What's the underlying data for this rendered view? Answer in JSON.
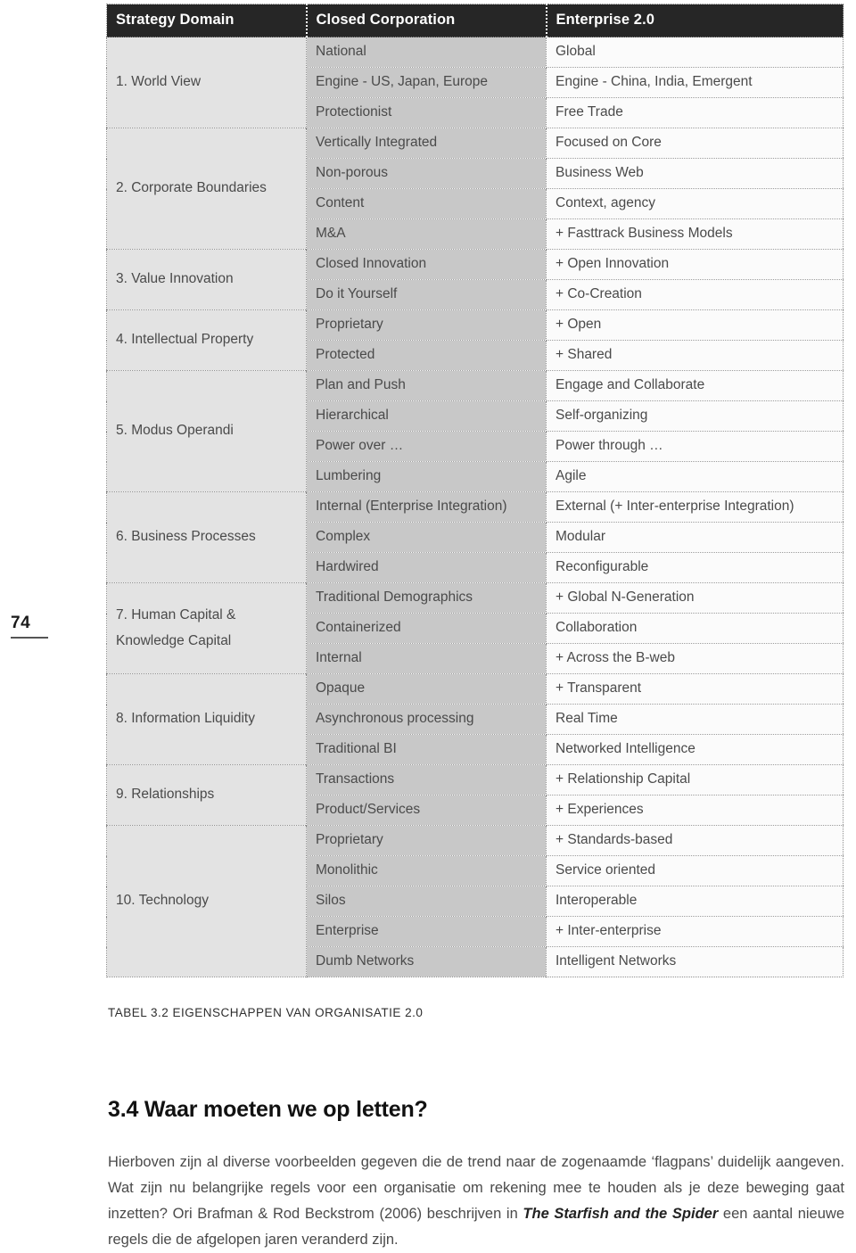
{
  "page": {
    "number": "74"
  },
  "table": {
    "headers": [
      "Strategy Domain",
      "Closed Corporation",
      "Enterprise 2.0"
    ],
    "caption": "TABEL 3.2 EIGENSCHAPPEN VAN ORGANISATIE 2.0",
    "colors": {
      "header_bg": "#262626",
      "header_text": "#ffffff",
      "col1_bg": "#e3e3e3",
      "col2_bg": "#c8c8c8",
      "col3_bg": "#fbfbfb",
      "body_text": "#4a4a4a",
      "border": "#8c8c8c"
    },
    "groups": [
      {
        "domain": "1. World View",
        "domain_line2": "",
        "rows": [
          {
            "closed": "National",
            "enterprise": "Global"
          },
          {
            "closed": "Engine - US, Japan, Europe",
            "enterprise": "Engine - China, India, Emergent"
          },
          {
            "closed": "Protectionist",
            "enterprise": "Free Trade"
          }
        ]
      },
      {
        "domain": "2. Corporate Boundaries",
        "domain_line2": "",
        "rows": [
          {
            "closed": "Vertically Integrated",
            "enterprise": "Focused on Core"
          },
          {
            "closed": "Non-porous",
            "enterprise": "Business Web"
          },
          {
            "closed": "Content",
            "enterprise": "Context, agency"
          },
          {
            "closed": "M&A",
            "enterprise": "+ Fasttrack Business Models"
          }
        ]
      },
      {
        "domain": "3. Value Innovation",
        "domain_line2": "",
        "rows": [
          {
            "closed": "Closed Innovation",
            "enterprise": "+ Open Innovation"
          },
          {
            "closed": "Do it Yourself",
            "enterprise": "+ Co-Creation"
          }
        ]
      },
      {
        "domain": "4. Intellectual Property",
        "domain_line2": "",
        "rows": [
          {
            "closed": "Proprietary",
            "enterprise": "+ Open"
          },
          {
            "closed": "Protected",
            "enterprise": "+ Shared"
          }
        ]
      },
      {
        "domain": "5. Modus Operandi",
        "domain_line2": "",
        "rows": [
          {
            "closed": "Plan and Push",
            "enterprise": "Engage and Collaborate"
          },
          {
            "closed": "Hierarchical",
            "enterprise": "Self-organizing"
          },
          {
            "closed": "Power over …",
            "enterprise": "Power through …"
          },
          {
            "closed": "Lumbering",
            "enterprise": "Agile"
          }
        ]
      },
      {
        "domain": "6. Business Processes",
        "domain_line2": "",
        "rows": [
          {
            "closed": "Internal (Enterprise Integration)",
            "enterprise": "External (+ Inter-enterprise Integration)"
          },
          {
            "closed": "Complex",
            "enterprise": "Modular"
          },
          {
            "closed": "Hardwired",
            "enterprise": "Reconfigurable"
          }
        ]
      },
      {
        "domain": "7. Human Capital &",
        "domain_line2": "Knowledge Capital",
        "rows": [
          {
            "closed": "Traditional Demographics",
            "enterprise": "+ Global N-Generation"
          },
          {
            "closed": "Containerized",
            "enterprise": "Collaboration"
          },
          {
            "closed": "Internal",
            "enterprise": "+ Across the B-web"
          }
        ]
      },
      {
        "domain": "8. Information Liquidity",
        "domain_line2": "",
        "rows": [
          {
            "closed": "Opaque",
            "enterprise": "+ Transparent"
          },
          {
            "closed": "Asynchronous processing",
            "enterprise": "Real Time"
          },
          {
            "closed": "Traditional BI",
            "enterprise": "Networked Intelligence"
          }
        ]
      },
      {
        "domain": "9. Relationships",
        "domain_line2": "",
        "rows": [
          {
            "closed": "Transactions",
            "enterprise": "+ Relationship Capital"
          },
          {
            "closed": "Product/Services",
            "enterprise": "+ Experiences"
          }
        ]
      },
      {
        "domain": "10. Technology",
        "domain_line2": "",
        "rows": [
          {
            "closed": "Proprietary",
            "enterprise": "+ Standards-based"
          },
          {
            "closed": "Monolithic",
            "enterprise": "Service oriented"
          },
          {
            "closed": "Silos",
            "enterprise": "Interoperable"
          },
          {
            "closed": "Enterprise",
            "enterprise": "+ Inter-enterprise"
          },
          {
            "closed": "Dumb Networks",
            "enterprise": "Intelligent Networks"
          }
        ]
      }
    ]
  },
  "section": {
    "heading": "3.4 Waar moeten we op letten?",
    "paragraph_part1": "Hierboven zijn al diverse voorbeelden gegeven die de trend naar de zogenaamde ‘flagpans’ duidelijk aangeven. Wat zijn nu belangrijke regels voor een organisatie om rekening mee te houden als je deze beweging gaat inzetten? Ori Brafman & Rod Beckstrom (2006) beschrijven in ",
    "paragraph_italic": "The Starfish and the Spider",
    "paragraph_part2": " een aantal nieuwe regels die de afgelopen jaren veranderd zijn."
  }
}
